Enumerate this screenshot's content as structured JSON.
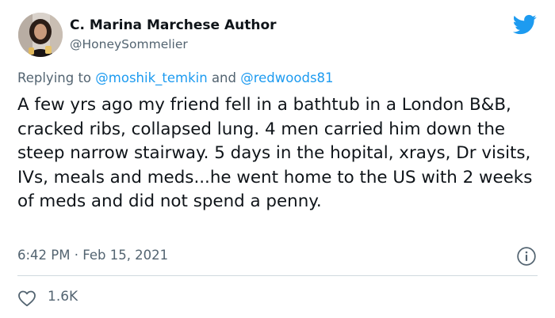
{
  "author": {
    "display_name": "C. Marina Marchese Author",
    "handle": "@HoneySommelier",
    "avatar_icon": "profile-photo"
  },
  "brand": {
    "icon": "twitter-bird-icon",
    "color": "#1d9bf0"
  },
  "reply": {
    "prefix": "Replying to",
    "mention_1": "@moshik_temkin",
    "conjunction": "and",
    "mention_2": "@redwoods81"
  },
  "tweet": {
    "text": "A few yrs ago my friend fell in a bathtub in a London B&B, cracked ribs, collapsed lung. 4 men carried him down the steep narrow stairway. 5 days in the hopital, xrays, Dr visits, IVs, meals and meds...he went home to the US with 2 weeks of meds and did not spend a penny.",
    "time": "6:42 PM",
    "separator": "·",
    "date": "Feb 15, 2021"
  },
  "actions": {
    "info_icon": "info-icon",
    "like_icon": "heart-icon",
    "like_count": "1.6K"
  }
}
